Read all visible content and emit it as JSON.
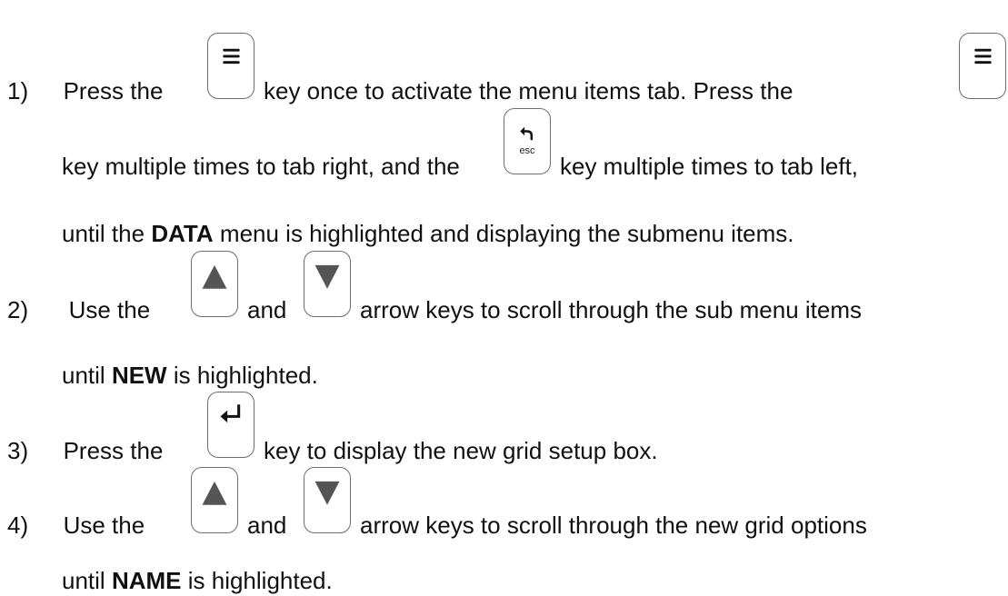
{
  "steps": [
    {
      "number": "1)",
      "line1": {
        "t1": "Press the",
        "t2": "key once to activate the menu items tab.  Press the"
      },
      "line2": {
        "t1": "key multiple times to tab right, and the",
        "t2": "key multiple times to tab left,"
      },
      "line3": {
        "t1": "until the",
        "b1": "DATA",
        "t2": "menu is highlighted and displaying the submenu items."
      }
    },
    {
      "number": "2)",
      "line1": {
        "t1": "Use the",
        "t2": "and",
        "t3": "arrow keys to scroll through the sub menu items"
      },
      "line2": {
        "t1": "until",
        "b1": "NEW",
        "t2": "is highlighted."
      }
    },
    {
      "number": "3)",
      "line1": {
        "t1": "Press the",
        "t2": "key to display the new grid setup box."
      }
    },
    {
      "number": "4)",
      "line1": {
        "t1": "Use the",
        "t2": "and",
        "t3": "arrow keys to scroll through the new grid options"
      },
      "line2": {
        "t1": "until",
        "b1": "NAME",
        "t2": "is highlighted."
      }
    }
  ],
  "keys": {
    "menu": "menu-icon",
    "back_esc": "back-arrow-icon",
    "esc_label": "esc",
    "up": "up-arrow-icon",
    "down": "down-arrow-icon",
    "enter": "enter-icon"
  }
}
